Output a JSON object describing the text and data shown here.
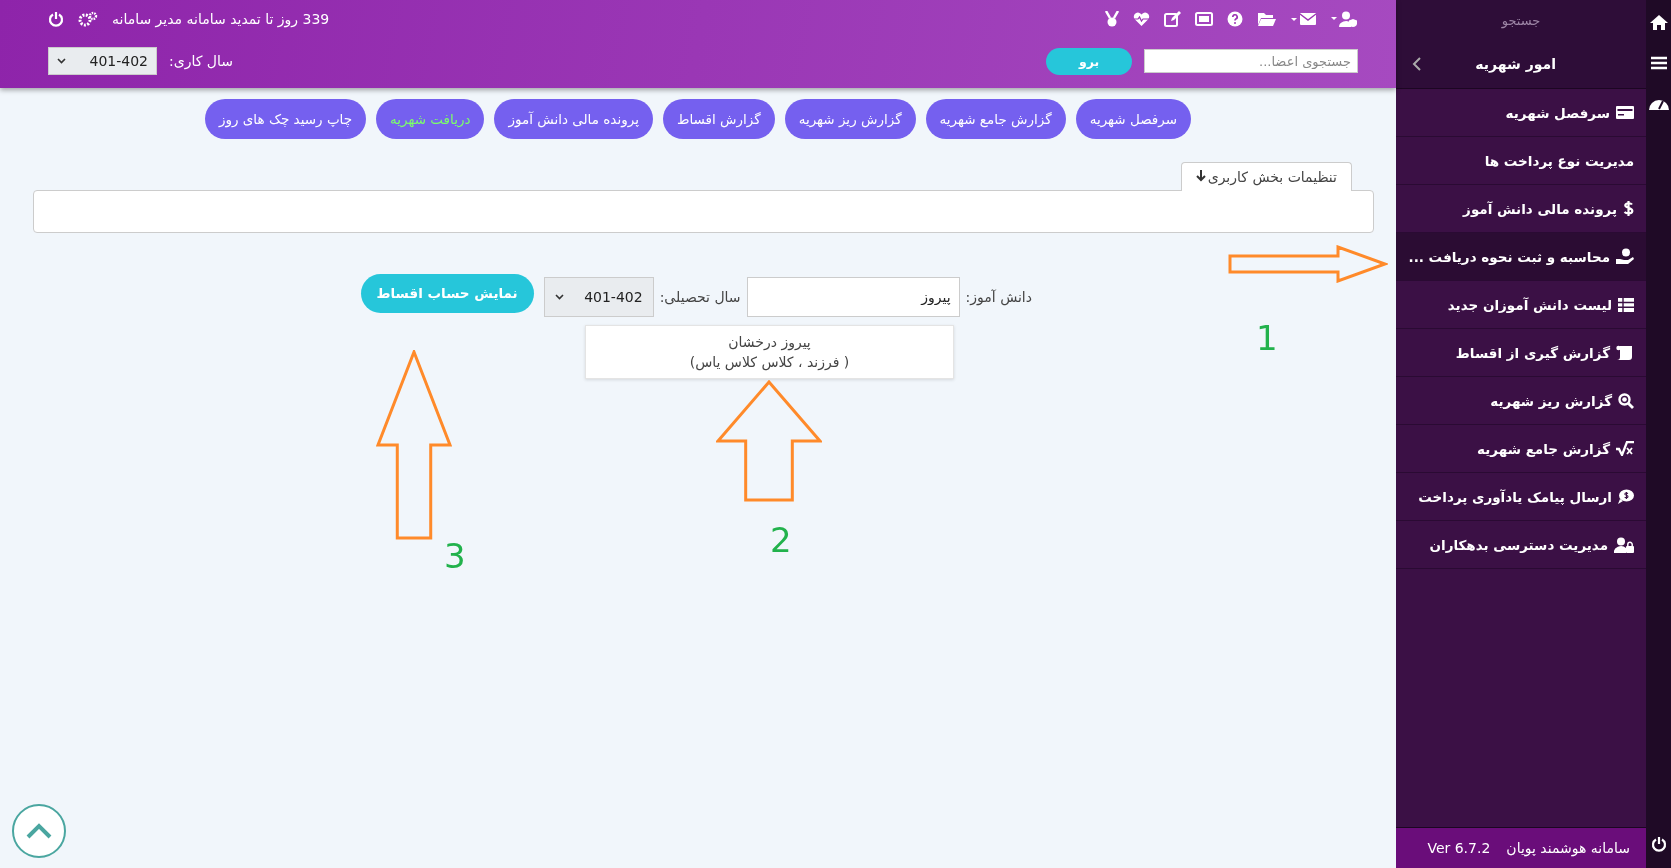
{
  "topbar": {
    "notice": "339 روز تا تمدید سامانه مدیر سامانه",
    "year_label": "سال کاری:",
    "year_value": "401-402",
    "search_placeholder": "جستجوی اعضا...",
    "go_button": "برو"
  },
  "toolbar": [
    {
      "label": "سرفصل شهریه",
      "selected": false
    },
    {
      "label": "گزارش جامع شهریه",
      "selected": false
    },
    {
      "label": "گزارش ریز شهریه",
      "selected": false
    },
    {
      "label": "گزارش اقساط",
      "selected": false
    },
    {
      "label": "پرونده مالی دانش آموز",
      "selected": false
    },
    {
      "label": "دریافت شهریه",
      "selected": true
    },
    {
      "label": "چاپ رسید چک های روز",
      "selected": false
    }
  ],
  "settings_tab": "تنظیمات بخش کاربری",
  "form": {
    "student_label": "دانش آموز:",
    "student_value": "پیروز",
    "year_label": "سال تحصیلی:",
    "year_value": "401-402",
    "submit": "نمایش حساب اقساط"
  },
  "suggestions": [
    {
      "name": "پیروز درخشان",
      "detail": "( فرزند ، کلاس کلاس یاس)"
    }
  ],
  "annotations": [
    {
      "kind": "right",
      "number": "1"
    },
    {
      "kind": "up",
      "number": "2"
    },
    {
      "kind": "up",
      "number": "3"
    }
  ],
  "sidebar": {
    "search_placeholder": "جستجو",
    "section": "امور شهریه",
    "items": [
      {
        "label": "سرفصل شهریه",
        "kind": "card",
        "selected": false
      },
      {
        "label": "مدیریت نوع پرداخت ها",
        "kind": "plain",
        "selected": false
      },
      {
        "label": "پرونده مالی دانش آموز",
        "kind": "dollar",
        "selected": false
      },
      {
        "label": "محاسبه و ثبت نحوه دریافت ...",
        "kind": "hand",
        "selected": true
      },
      {
        "label": "لیست دانش آموزان جدید",
        "kind": "table",
        "selected": false
      },
      {
        "label": "گزارش گیری از اقساط",
        "kind": "scroll",
        "selected": false
      },
      {
        "label": "گزارش ریز شهریه",
        "kind": "search",
        "selected": false
      },
      {
        "label": "گزارش جامع شهریه",
        "kind": "sqrt",
        "selected": false
      },
      {
        "label": "ارسال پیامک یادآوری پرداخت",
        "kind": "sms",
        "selected": false
      },
      {
        "label": "مدیریت دسترسی بدهکاران",
        "kind": "userlock",
        "selected": false
      }
    ]
  },
  "footer": {
    "title": "سامانه هوشمند پویان",
    "version": "Ver 6.7.2"
  }
}
